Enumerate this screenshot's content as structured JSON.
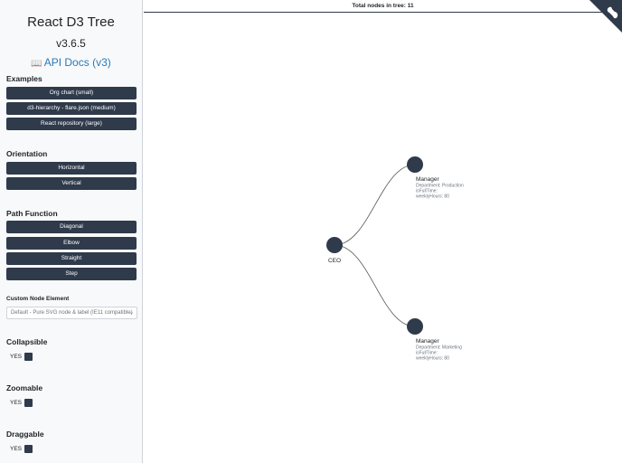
{
  "sidebar": {
    "title": "React D3 Tree",
    "version": "v3.6.5",
    "docs_icon": "book-icon",
    "docs_icon_glyph": "📖",
    "docs_label": "API Docs (v3)",
    "examples": {
      "title": "Examples",
      "buttons": [
        "Org chart (small)",
        "d3-hierarchy - flare.json (medium)",
        "React repository (large)"
      ]
    },
    "orientation": {
      "title": "Orientation",
      "buttons": [
        "Horizontal",
        "Vertical"
      ]
    },
    "path_function": {
      "title": "Path Function",
      "buttons": [
        "Diagonal",
        "Elbow",
        "Straight",
        "Step"
      ]
    },
    "custom_node": {
      "title": "Custom Node Element",
      "selected": "Default - Pure SVG node & label (IE11 compatible)"
    },
    "collapsible": {
      "title": "Collapsible",
      "value": "YES"
    },
    "zoomable": {
      "title": "Zoomable",
      "value": "YES"
    },
    "draggable": {
      "title": "Draggable",
      "value": "YES"
    }
  },
  "main": {
    "total_nodes_label": "Total nodes in tree: 11",
    "corner_icon": "github-corner-icon"
  },
  "tree": {
    "root": {
      "name": "CEO"
    },
    "children": [
      {
        "name": "Manager",
        "attributes": [
          "Department: Production",
          "isFullTime:",
          "weeklyHours: 80"
        ]
      },
      {
        "name": "Manager",
        "attributes": [
          "Department: Marketing",
          "isFullTime:",
          "weeklyHours: 80"
        ]
      }
    ]
  },
  "colors": {
    "dark": "#2f3a4b",
    "link": "#2a7ab9",
    "sidebar_bg": "#f8f9fa"
  }
}
